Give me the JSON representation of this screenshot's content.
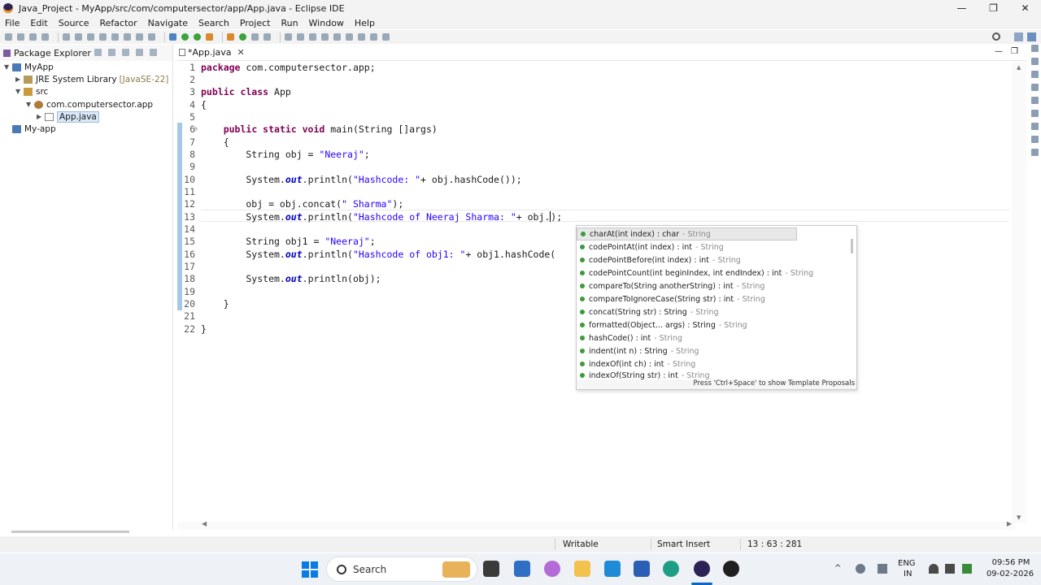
{
  "window": {
    "title": "Java_Project - MyApp/src/com/computersector/app/App.java - Eclipse IDE",
    "controls": [
      "—",
      "❐",
      "✕"
    ]
  },
  "menu": [
    "File",
    "Edit",
    "Source",
    "Refactor",
    "Navigate",
    "Search",
    "Project",
    "Run",
    "Window",
    "Help"
  ],
  "package_explorer": {
    "title": "Package Explorer",
    "tree": [
      {
        "label": "MyApp",
        "deco": ""
      },
      {
        "label": "JRE System Library",
        "deco": "[JavaSE-22]"
      },
      {
        "label": "src",
        "deco": ""
      },
      {
        "label": "com.computersector.app",
        "deco": ""
      },
      {
        "label": "App.java",
        "deco": ""
      },
      {
        "label": "My-app",
        "deco": ""
      }
    ]
  },
  "editor": {
    "tab_label": "*App.java",
    "line_numbers": [
      "1",
      "2",
      "3",
      "4",
      "5",
      "6",
      "7",
      "8",
      "9",
      "10",
      "11",
      "12",
      "13",
      "14",
      "15",
      "16",
      "17",
      "18",
      "19",
      "20",
      "21",
      "22"
    ],
    "code": {
      "l1_kw": "package",
      "l1_rest": " com.computersector.app;",
      "l3_kw": "public class",
      "l3_rest": " App",
      "l4": "{",
      "l6_indent": "    ",
      "l6_kw": "public static void",
      "l6_rest": " main(String []args)",
      "l7": "    {",
      "l8_a": "        String obj = ",
      "l8_str": "\"Neeraj\"",
      "l8_b": ";",
      "l10_a": "        System.",
      "l10_fld": "out",
      "l10_b": ".println(",
      "l10_str": "\"Hashcode: \"",
      "l10_c": "+ obj.hashCode());",
      "l12_a": "        obj = obj.concat(",
      "l12_str": "\" Sharma\"",
      "l12_b": ");",
      "l13_a": "        System.",
      "l13_fld": "out",
      "l13_b": ".println(",
      "l13_str": "\"Hashcode of Neeraj Sharma: \"",
      "l13_c": "+ obj.",
      "l13_d": ");",
      "l15_a": "        String obj1 = ",
      "l15_str": "\"Neeraj\"",
      "l15_b": ";",
      "l16_a": "        System.",
      "l16_fld": "out",
      "l16_b": ".println(",
      "l16_str": "\"Hashcode of obj1: \"",
      "l16_c": "+ obj1.hashCode(",
      "l18_a": "        System.",
      "l18_fld": "out",
      "l18_b": ".println(obj);",
      "l20": "    }",
      "l21": "}"
    }
  },
  "content_assist": {
    "items": [
      {
        "sig": "charAt(int index) : char",
        "decl": "- String"
      },
      {
        "sig": "codePointAt(int index) : int",
        "decl": "- String"
      },
      {
        "sig": "codePointBefore(int index) : int",
        "decl": "- String"
      },
      {
        "sig": "codePointCount(int beginIndex, int endIndex) : int",
        "decl": "- String"
      },
      {
        "sig": "compareTo(String anotherString) : int",
        "decl": "- String"
      },
      {
        "sig": "compareToIgnoreCase(String str) : int",
        "decl": "- String"
      },
      {
        "sig": "concat(String str) : String",
        "decl": "- String"
      },
      {
        "sig": "formatted(Object... args) : String",
        "decl": "- String"
      },
      {
        "sig": "hashCode() : int",
        "decl": "- String"
      },
      {
        "sig": "indent(int n) : String",
        "decl": "- String"
      },
      {
        "sig": "indexOf(int ch) : int",
        "decl": "- String"
      },
      {
        "sig": "indexOf(String str) : int",
        "decl": "- String"
      }
    ],
    "footer": "Press 'Ctrl+Space' to show Template Proposals"
  },
  "status_bar": {
    "mode": "Writable",
    "insert": "Smart Insert",
    "position": "13 : 63 : 281"
  },
  "taskbar": {
    "search_placeholder": "Search",
    "lang_top": "ENG",
    "lang_bottom": "IN",
    "time": "09:56 PM",
    "date": "09-02-2026"
  }
}
